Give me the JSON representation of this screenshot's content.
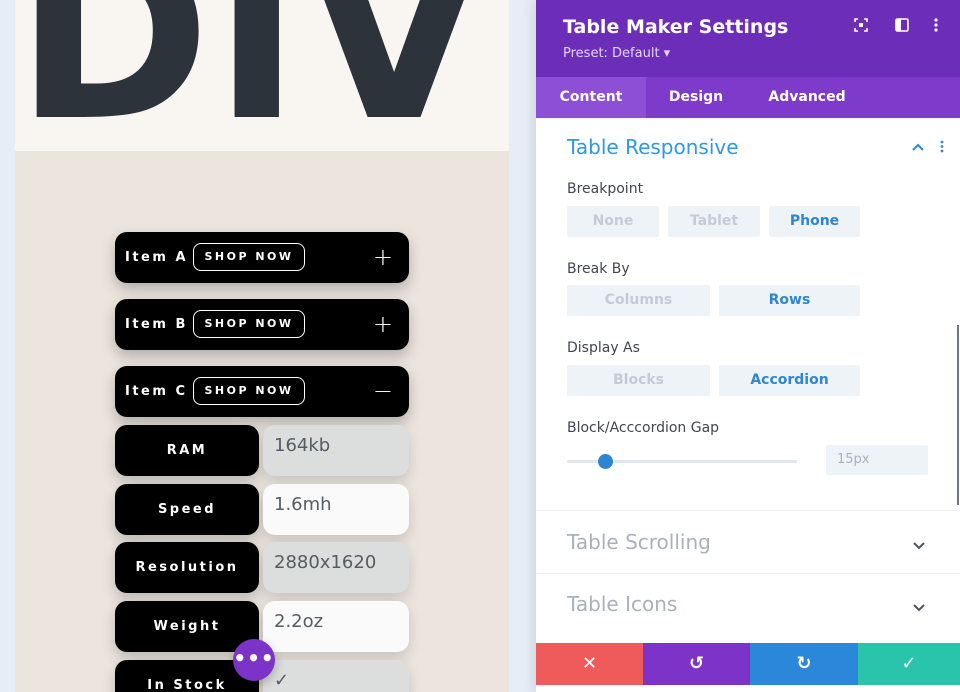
{
  "preview": {
    "hero_text": "DIVI",
    "accordion": [
      {
        "label": "Item A",
        "button": "SHOP NOW",
        "sign": "+"
      },
      {
        "label": "Item B",
        "button": "SHOP NOW",
        "sign": "+"
      },
      {
        "label": "Item C",
        "button": "SHOP NOW",
        "sign": "−"
      }
    ],
    "rows": [
      {
        "key": "RAM",
        "value": "164kb"
      },
      {
        "key": "Speed",
        "value": "1.6mh"
      },
      {
        "key": "Resolution",
        "value": "2880x1620"
      },
      {
        "key": "Weight",
        "value": "2.2oz"
      },
      {
        "key": "In Stock",
        "value": "✓"
      }
    ],
    "fab_label": "•••"
  },
  "panel": {
    "title": "Table Maker Settings",
    "preset": "Preset: Default ▾",
    "header_icons": [
      "focus-icon",
      "split-view-icon",
      "more-vertical-icon"
    ],
    "tabs": [
      {
        "label": "Content",
        "active": true
      },
      {
        "label": "Design",
        "active": false
      },
      {
        "label": "Advanced",
        "active": false
      }
    ],
    "sections": {
      "responsive": {
        "title": "Table Responsive",
        "breakpoint": {
          "label": "Breakpoint",
          "options": [
            "None",
            "Tablet",
            "Phone"
          ],
          "selected": "Phone"
        },
        "break_by": {
          "label": "Break By",
          "options": [
            "Columns",
            "Rows"
          ],
          "selected": "Rows"
        },
        "display_as": {
          "label": "Display As",
          "options": [
            "Blocks",
            "Accordion"
          ],
          "selected": "Accordion"
        },
        "gap": {
          "label": "Block/Acccordion Gap",
          "value": "15px",
          "slider_fraction": 0.17
        }
      },
      "scrolling": {
        "title": "Table Scrolling"
      },
      "icons": {
        "title": "Table Icons"
      }
    },
    "footer": {
      "cancel": "✕",
      "undo": "↺",
      "redo": "↻",
      "save": "✓",
      "colors": {
        "cancel": "#ef5a5a",
        "undo": "#7d33c8",
        "redo": "#2b87da",
        "save": "#29c4a9"
      }
    }
  },
  "colors": {
    "accent": "#2e99e0",
    "header": "#6c2eb9",
    "tabs": "#7d3acb"
  }
}
